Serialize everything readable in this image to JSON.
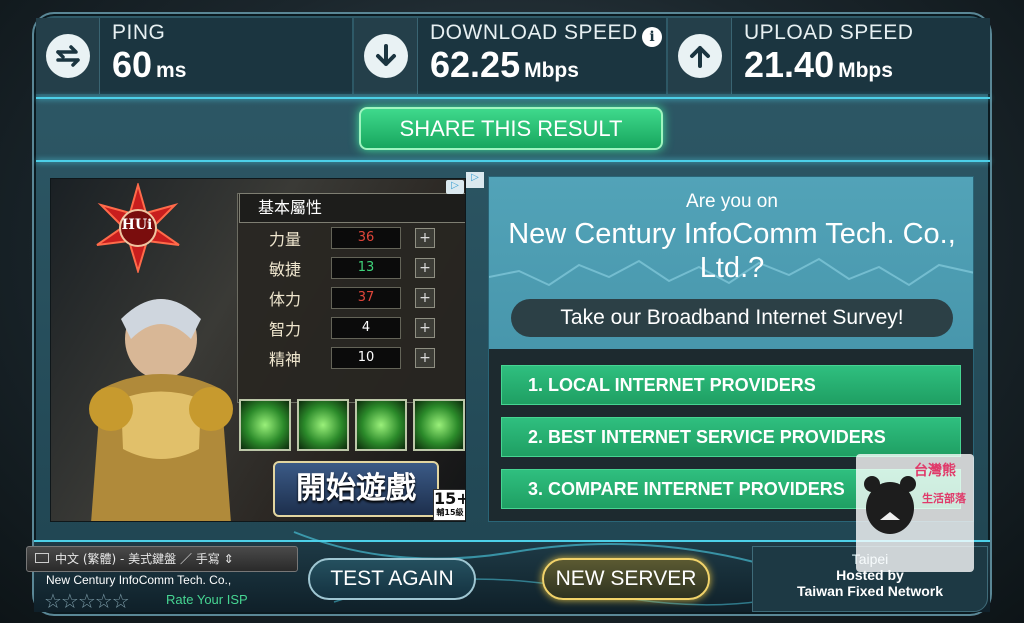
{
  "header": {
    "ping": {
      "label": "PING",
      "value": "60",
      "unit": "ms",
      "icon": "swap-arrows-icon"
    },
    "download": {
      "label": "DOWNLOAD SPEED",
      "value": "62.25",
      "unit": "Mbps",
      "icon": "arrow-down-icon",
      "info_icon": "info-icon"
    },
    "upload": {
      "label": "UPLOAD SPEED",
      "value": "21.40",
      "unit": "Mbps",
      "icon": "arrow-up-icon"
    }
  },
  "share_label": "SHARE THIS RESULT",
  "game_ad": {
    "title": "基本屬性",
    "attributes": [
      {
        "name": "力量",
        "value": "36",
        "color": "#e0463a"
      },
      {
        "name": "敏捷",
        "value": "13",
        "color": "#3fd37a"
      },
      {
        "name": "体力",
        "value": "37",
        "color": "#e0463a"
      },
      {
        "name": "智力",
        "value": "4",
        "color": "#ffffff"
      },
      {
        "name": "精神",
        "value": "10",
        "color": "#ffffff"
      }
    ],
    "plus": "+",
    "start_button": "開始遊戲",
    "age_rating": "15+",
    "age_note": "輔15級",
    "logo_text": "HUi"
  },
  "survey_ad": {
    "question": "Are you on",
    "isp": "New Century InfoComm Tech. Co., Ltd.?",
    "cta": "Take our Broadband Internet Survey!",
    "providers": [
      "1.  LOCAL INTERNET PROVIDERS",
      "2.  BEST INTERNET SERVICE PROVIDERS",
      "3.  COMPARE INTERNET PROVIDERS"
    ]
  },
  "ime": {
    "text": "中文 (繁體) - 美式鍵盤 ／ 手寫 ⇕"
  },
  "isp_bar": {
    "name": "New Century InfoComm Tech. Co.,",
    "stars": "☆☆☆☆☆",
    "rate_label": "Rate Your ISP"
  },
  "test_again_label": "TEST AGAIN",
  "new_server_label": "NEW SERVER",
  "server": {
    "city": "Taipei",
    "hosted_line": "Hosted by",
    "host": "Taiwan Fixed Network"
  },
  "watermark": {
    "text1": "台灣熊",
    "text2": "生活部落"
  },
  "colors": {
    "accent_green": "#2fbf7f",
    "glow_blue": "#4dd0e8",
    "frame": "#1f4451"
  }
}
